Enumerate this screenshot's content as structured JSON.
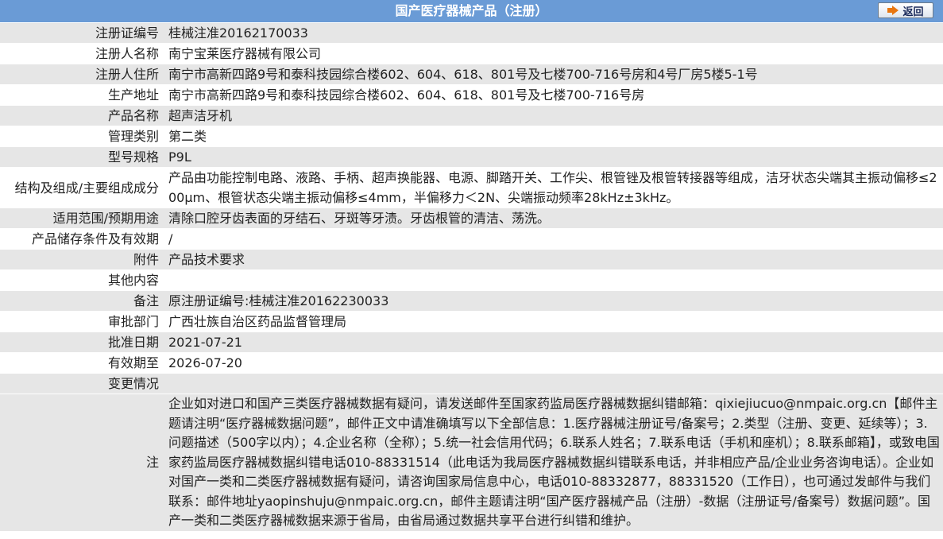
{
  "header": {
    "title": "国产医疗器械产品（注册）",
    "back_label": "返回"
  },
  "rows": [
    {
      "label": "注册证编号",
      "value": "桂械注准20162170033"
    },
    {
      "label": "注册人名称",
      "value": "南宁宝莱医疗器械有限公司"
    },
    {
      "label": "注册人住所",
      "value": "南宁市高新四路9号和泰科技园综合楼602、604、618、801号及七楼700-716号房和4号厂房5楼5-1号"
    },
    {
      "label": "生产地址",
      "value": "南宁市高新四路9号和泰科技园综合楼602、604、618、801号及七楼700-716号房"
    },
    {
      "label": "产品名称",
      "value": "超声洁牙机"
    },
    {
      "label": "管理类别",
      "value": "第二类"
    },
    {
      "label": "型号规格",
      "value": "P9L"
    },
    {
      "label": "结构及组成/主要组成成分",
      "value": "产品由功能控制电路、液路、手柄、超声换能器、电源、脚踏开关、工作尖、根管锉及根管转接器等组成，洁牙状态尖端其主振动偏移≤200μm、根管状态尖端主振动偏移≤4mm，半偏移力＜2N、尖端振动频率28kHz±3kHz。"
    },
    {
      "label": "适用范围/预期用途",
      "value": "清除口腔牙齿表面的牙结石、牙斑等牙渍。牙齿根管的清洁、荡洗。"
    },
    {
      "label": "产品储存条件及有效期",
      "value": "/"
    },
    {
      "label": "附件",
      "value": "产品技术要求"
    },
    {
      "label": "其他内容",
      "value": ""
    },
    {
      "label": "备注",
      "value": "原注册证编号:桂械注准20162230033"
    },
    {
      "label": "审批部门",
      "value": "广西壮族自治区药品监督管理局"
    },
    {
      "label": "批准日期",
      "value": "2021-07-21"
    },
    {
      "label": "有效期至",
      "value": "2026-07-20"
    },
    {
      "label": "变更情况",
      "value": ""
    },
    {
      "label": "注",
      "value": "企业如对进口和国产三类医疗器械数据有疑问，请发送邮件至国家药监局医疗器械数据纠错邮箱：qixiejiucuo@nmpaic.org.cn【邮件主题请注明“医疗器械数据问题”，邮件正文中请准确填写以下全部信息：1.医疗器械注册证号/备案号；2.类型（注册、变更、延续等）；3.问题描述（500字以内）；4.企业名称（全称）；5.统一社会信用代码；6.联系人姓名；7.联系电话（手机和座机）；8.联系邮箱】，或致电国家药监局医疗器械数据纠错电话010-88331514（此电话为我局医疗器械数据纠错联系电话，并非相应产品/企业业务咨询电话）。企业如对国产一类和二类医疗器械数据有疑问，请咨询国家局信息中心，电话010-88332877，88331520（工作日），也可通过发邮件与我们联系：邮件地址yaopinshuju@nmpaic.org.cn，邮件主题请注明“国产医疗器械产品（注册）-数据（注册证号/备案号）数据问题”。国产一类和二类医疗器械数据来源于省局，由省局通过数据共享平台进行纠错和维护。"
    }
  ]
}
